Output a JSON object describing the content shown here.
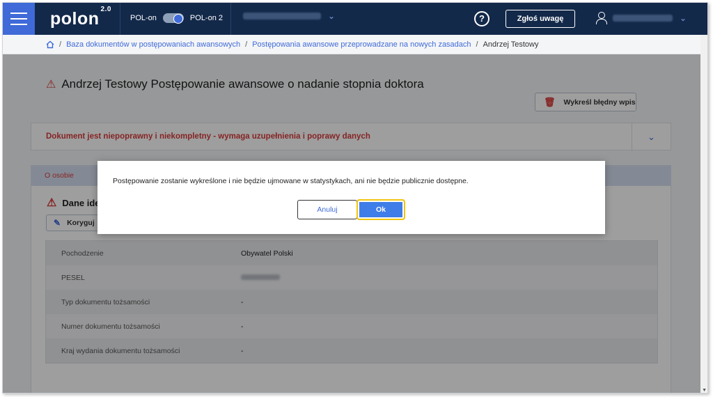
{
  "header": {
    "logo": "polon",
    "logo_version": "2.0",
    "toggle_left": "POL-on",
    "toggle_right": "POL-on 2",
    "help_label": "?",
    "report_button": "Zgłoś uwagę"
  },
  "breadcrumb": {
    "items": [
      "Baza dokumentów w postępowaniach awansowych",
      "Postępowania awansowe przeprowadzane na nowych zasadach"
    ],
    "current": "Andrzej Testowy",
    "separator": "/"
  },
  "page": {
    "title": "Andrzej Testowy Postępowanie awansowe o nadanie stopnia doktora",
    "strike_button": "Wykreśl błędny wpis",
    "error_message": "Dokument jest niepoprawny i niekompletny - wymaga uzupełnienia i poprawy danych",
    "section_label": "O osobie",
    "subsection_title": "Dane ident",
    "edit_button": "Koryguj",
    "rows": [
      {
        "label": "Pochodzenie",
        "value": "Obywatel Polski"
      },
      {
        "label": "PESEL",
        "value": ""
      },
      {
        "label": "Typ dokumentu tożsamości",
        "value": "-"
      },
      {
        "label": "Numer dokumentu tożsamości",
        "value": "-"
      },
      {
        "label": "Kraj wydania dokumentu tożsamości",
        "value": "-"
      }
    ]
  },
  "modal": {
    "message": "Postępowanie zostanie wykreślone i nie będzie ujmowane w statystykach, ani nie będzie publicznie dostępne.",
    "cancel_label": "Anuluj",
    "ok_label": "Ok"
  },
  "colors": {
    "topbar": "#13294a",
    "accent": "#3f6ad8",
    "error": "#d93a3a",
    "focus_ring": "#f1c40f"
  },
  "icons": [
    "menu-icon",
    "chevron-down-icon",
    "help-icon",
    "user-icon",
    "home-icon",
    "warning-icon",
    "trash-icon",
    "pencil-icon"
  ]
}
